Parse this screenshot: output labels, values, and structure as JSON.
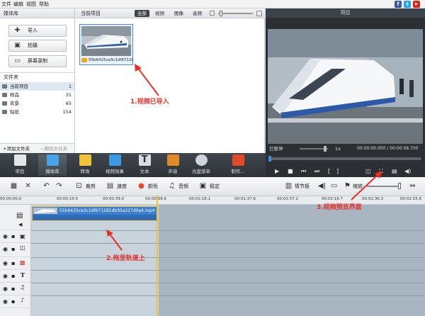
{
  "menu": {
    "file": "文件",
    "edit": "编辑",
    "view": "视图",
    "help": "帮助"
  },
  "social": {
    "facebook": "f",
    "twitter": "t",
    "youtube": "▶"
  },
  "library": {
    "title": "媒体库",
    "buttons": [
      {
        "label": "导入"
      },
      {
        "label": "拍摄"
      },
      {
        "label": "屏幕录制"
      }
    ],
    "folders_title": "文件夹",
    "folders": [
      {
        "name": "当前项目",
        "count": "1"
      },
      {
        "name": "样品",
        "count": "31"
      },
      {
        "name": "背景",
        "count": "65"
      },
      {
        "name": "贴纸",
        "count": "154"
      }
    ],
    "add_folder": "添加文件夹",
    "delete_folder": "删除文件夹"
  },
  "media": {
    "title": "当前项目",
    "tabs": [
      "全部",
      "视频",
      "图像",
      "音频"
    ],
    "thumb_name": "55b6425ce3c1df671281..."
  },
  "preview": {
    "title": "项目",
    "status": "已暂停",
    "speed": "1x",
    "time": "00:00:00.000 / 00:00:58.700"
  },
  "toolbar": {
    "items": [
      "项目",
      "媒体库",
      "转场",
      "视频效果",
      "文本",
      "声音",
      "光盘菜单",
      "制作..."
    ]
  },
  "editbar": {
    "crop": "裁剪",
    "speed": "速度",
    "color": "颜色",
    "audio": "音频",
    "stabilize": "稳定",
    "storyboard": "情节板",
    "zoom": "缩放:"
  },
  "ruler": [
    "00:00:00.0",
    "00:00:19.5",
    "00:00:39.0",
    "00:00:58.6",
    "00:01:18.1",
    "00:01:37.6",
    "00:01:57.2",
    "00:02:16.7",
    "00:02:36.3",
    "00:02:55.8"
  ],
  "clip": {
    "name": "55b6425ce3c1df671281db30a227d0a4.mp4"
  },
  "annotations": {
    "a1": "1.视频已导入",
    "a2": "2.拖至轨道上",
    "a3": "3.视频预览界面"
  }
}
